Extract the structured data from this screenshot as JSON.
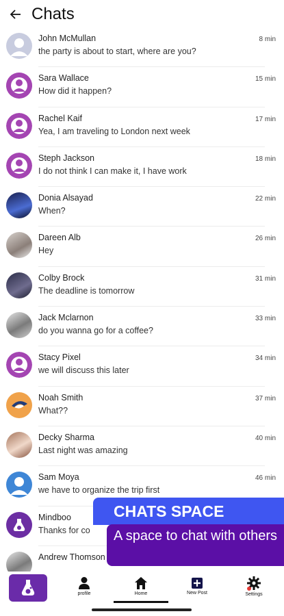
{
  "header": {
    "title": "Chats"
  },
  "chats": [
    {
      "name": "John McMullan",
      "message": "the party is about to start, where are you?",
      "time": "8 min",
      "avatar": "default-grey"
    },
    {
      "name": "Sara Wallace",
      "message": "How did it happen?",
      "time": "15 min",
      "avatar": "default-purple"
    },
    {
      "name": "Rachel Kaif",
      "message": "Yea, I am traveling to London next week",
      "time": "17 min",
      "avatar": "default-purple"
    },
    {
      "name": "Steph Jackson",
      "message": "I do not think I can make it, I have work",
      "time": "18 min",
      "avatar": "default-purple"
    },
    {
      "name": "Donia Alsayad",
      "message": "When?",
      "time": "22 min",
      "avatar": "photo"
    },
    {
      "name": "Dareen Alb",
      "message": "Hey",
      "time": "26 min",
      "avatar": "photo"
    },
    {
      "name": "Colby Brock",
      "message": "The deadline is tomorrow",
      "time": "31 min",
      "avatar": "photo"
    },
    {
      "name": "Jack Mclarnon",
      "message": "do you wanna go for a coffee?",
      "time": "33 min",
      "avatar": "photo"
    },
    {
      "name": "Stacy Pixel",
      "message": "we will discuss this later",
      "time": "34 min",
      "avatar": "default-purple"
    },
    {
      "name": "Noah Smith",
      "message": "What??",
      "time": "37 min",
      "avatar": "photo"
    },
    {
      "name": "Decky Sharma",
      "message": "Last night was amazing",
      "time": "40 min",
      "avatar": "photo"
    },
    {
      "name": "Sam Moya",
      "message": "we have to organize the trip first",
      "time": "46 min",
      "avatar": "default-blue"
    },
    {
      "name": "Mindboo",
      "message": "Thanks for co",
      "time": "",
      "avatar": "brand"
    },
    {
      "name": "Andrew Thomson",
      "message": "",
      "time": "",
      "avatar": "photo"
    }
  ],
  "banner": {
    "headline": "CHATS SPACE",
    "subline": "A space to chat with others"
  },
  "nav": {
    "profile": "profile",
    "home": "Home",
    "new_post": "New Post",
    "settings": "Settings"
  },
  "colors": {
    "accent_purple": "#6a2ba9",
    "banner_blue": "#3f56f1",
    "banner_purple": "#5b0fa6",
    "notification_dot": "#e53935"
  }
}
